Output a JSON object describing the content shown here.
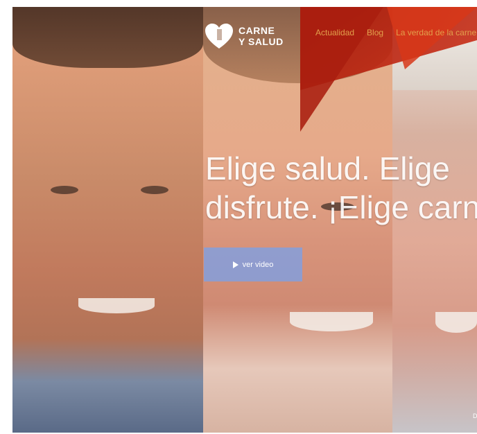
{
  "logo": {
    "line1": "CARNE",
    "line2": "Y SALUD",
    "icon": "heart-logo-icon"
  },
  "nav": {
    "items": [
      {
        "label": "Actualidad"
      },
      {
        "label": "Blog"
      },
      {
        "label": "La verdad de la carne"
      }
    ]
  },
  "hero": {
    "headline_line1": "Elige salud. Elige",
    "headline_line2": "disfrute. ¡Elige carne",
    "video_button": "ver video",
    "corner_text": "D"
  },
  "colors": {
    "accent_red": "#aa1e0f",
    "nav_orange": "#e2a04c",
    "button_blue": "#78a0eb"
  }
}
